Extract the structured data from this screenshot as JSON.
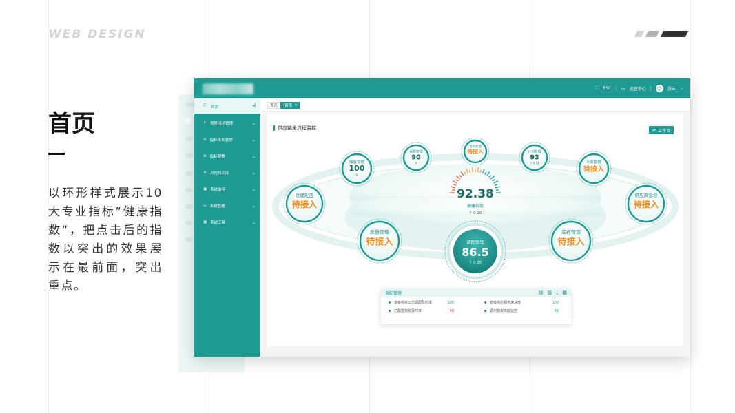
{
  "slide": {
    "brand": "WEB DESIGN",
    "title": "首页",
    "description": "以环形样式展示10大专业指标“健康指数”，把点击后的指数以突出的效果展示在最前面，突出重点。",
    "stripe_colors": [
      "#cfcfcf",
      "#b3b3b3",
      "#333333"
    ]
  },
  "app": {
    "topbar": {
      "esc_label": "ESC",
      "ops_center_label": "运营中心",
      "user_name": "张三"
    },
    "sidebar": {
      "home_label": "首页",
      "items": [
        {
          "label": "预警闭环管理",
          "icon": "alert-loop-icon"
        },
        {
          "label": "指标体系管理",
          "icon": "indicator-icon"
        },
        {
          "label": "指标配置",
          "icon": "config-icon"
        },
        {
          "label": "风险知识库",
          "icon": "risk-knowledge-icon"
        },
        {
          "label": "系统监控",
          "icon": "monitor-icon"
        },
        {
          "label": "系统管理",
          "icon": "system-icon"
        },
        {
          "label": "系统工具",
          "icon": "tools-icon"
        }
      ]
    },
    "tabs": [
      {
        "label": "首页",
        "active": false
      },
      {
        "label": "首页",
        "active": true,
        "close": "×"
      }
    ],
    "panel": {
      "title": "供应链全流程监控",
      "workbench_label": "工作台"
    },
    "health": {
      "value": "92.38",
      "label": "健康指数",
      "delta": "↑ 0.10"
    },
    "focus_node": {
      "label": "调配管理",
      "value": "86.5",
      "delta": "↑ 0.25"
    },
    "nodes": [
      {
        "label": "储备管理",
        "value": "100",
        "delta": "0",
        "pending": false
      },
      {
        "label": "采购管理",
        "value": "90",
        "delta": "0",
        "pending": false
      },
      {
        "label": "合同管理",
        "value": "待接入",
        "delta": "",
        "pending": true
      },
      {
        "label": "计划管理",
        "value": "93",
        "delta": "↑ 0.14",
        "pending": false
      },
      {
        "label": "专家管理",
        "value": "待接入",
        "delta": "",
        "pending": true
      },
      {
        "label": "供应商管理",
        "value": "待接入",
        "delta": "",
        "pending": true
      },
      {
        "label": "库存管理",
        "value": "待接入",
        "delta": "",
        "pending": true
      },
      {
        "label": "质量管理",
        "value": "待接入",
        "delta": "",
        "pending": true
      },
      {
        "label": "仓储配送",
        "value": "待接入",
        "delta": "",
        "pending": true
      }
    ],
    "detail": {
      "title": "调配管理",
      "metrics": [
        {
          "label": "省级物资公司调配及时率",
          "value": "100",
          "alert": false
        },
        {
          "label": "省级供应服务满意度",
          "value": "100",
          "alert": false
        },
        {
          "label": "已配送物资及时率",
          "value": "48",
          "alert": true
        },
        {
          "label": "调剂物资库龄监控",
          "value": "98",
          "alert": false
        }
      ]
    },
    "colors": {
      "primary": "#1e9a93",
      "pending": "#f08c1a",
      "alert": "#e23b3b"
    }
  }
}
